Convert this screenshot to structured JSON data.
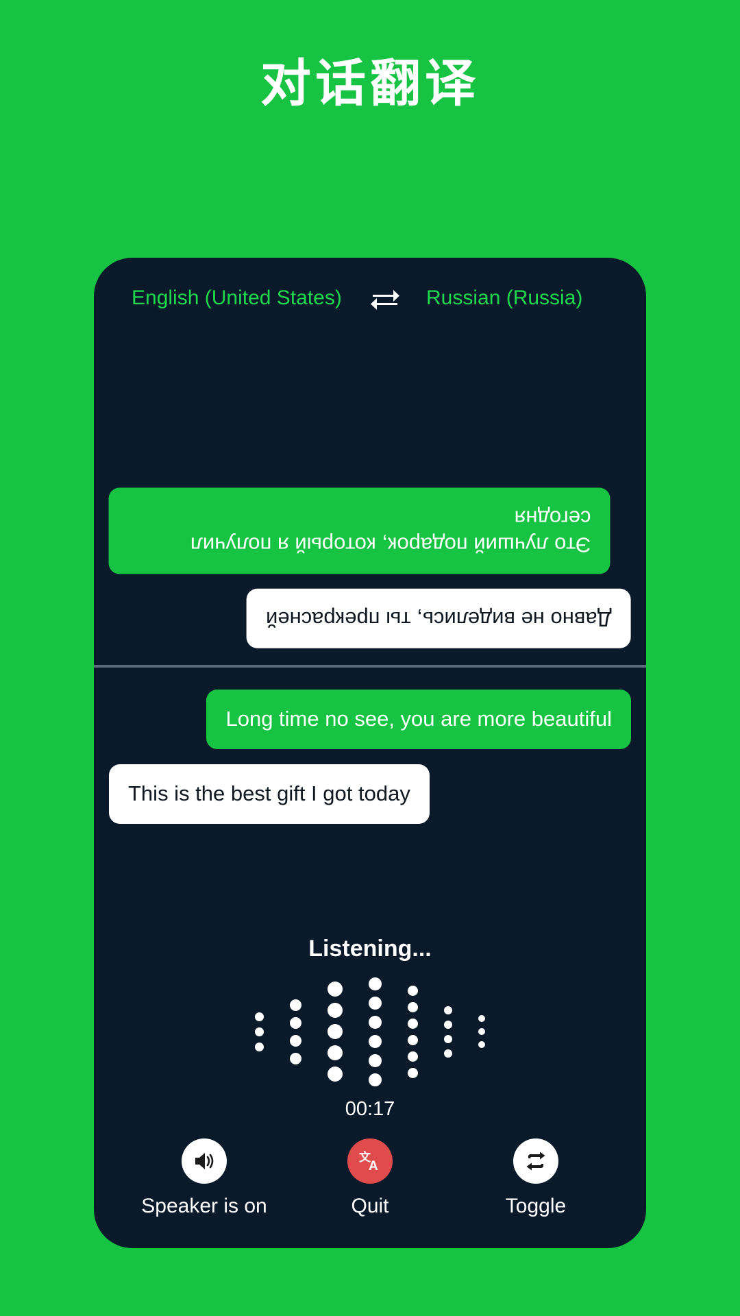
{
  "page": {
    "title": "对话翻译",
    "background_color": "#16c342",
    "panel_color": "#0b1a2a"
  },
  "header": {
    "source_language": "English (United States)",
    "target_language": "Russian (Russia)",
    "swap_icon": "swap-horizontal-icon"
  },
  "remote_pane": {
    "flipped": true,
    "messages": [
      {
        "text": "Это лучший подарок, который я получил сегодня",
        "style": "green",
        "align": "left"
      },
      {
        "text": "Давно не виделись, ты прекрасней",
        "style": "white",
        "align": "right"
      }
    ]
  },
  "local_pane": {
    "flipped": false,
    "messages": [
      {
        "text": "Long time no see, you are more beautiful",
        "style": "green",
        "align": "right"
      },
      {
        "text": "This is the best gift I got today",
        "style": "white",
        "align": "left"
      }
    ]
  },
  "recorder": {
    "status": "Listening...",
    "timer": "00:17",
    "waveform": {
      "columns": [
        {
          "dots": 3,
          "size": 13
        },
        {
          "dots": 4,
          "size": 17
        },
        {
          "dots": 5,
          "size": 22
        },
        {
          "dots": 6,
          "size": 19
        },
        {
          "dots": 6,
          "size": 15
        },
        {
          "dots": 4,
          "size": 12
        },
        {
          "dots": 3,
          "size": 10
        }
      ]
    }
  },
  "controls": [
    {
      "label": "Speaker is on",
      "icon": "speaker-on-icon",
      "circle": "white",
      "name": "speaker-button"
    },
    {
      "label": "Quit",
      "icon": "translate-icon",
      "circle": "red",
      "name": "quit-button"
    },
    {
      "label": "Toggle",
      "icon": "repeat-swap-icon",
      "circle": "white",
      "name": "toggle-button"
    }
  ],
  "colors": {
    "accent_green": "#16c342",
    "bubble_green": "#16c342",
    "lang_green": "#1fd94d",
    "quit_red": "#e04b4b",
    "divider": "#5c6b7a"
  }
}
